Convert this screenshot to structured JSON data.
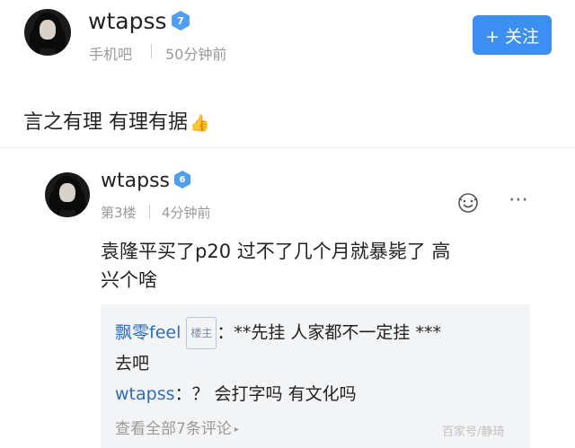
{
  "post": {
    "username": "wtapss",
    "level": "7",
    "source": "手机吧",
    "time": "50分钟前",
    "follow_label": "+ 关注",
    "content": "言之有理 有理有据",
    "content_emoji": "👍"
  },
  "reply": {
    "username": "wtapss",
    "level": "6",
    "floor": "第3楼",
    "time": "4分钟前",
    "content_line1": "袁隆平买了p20 过不了几个月就暴毙了 高",
    "content_line2": "兴个啥",
    "sub_comments": [
      {
        "user": "飘零feel",
        "badge": "楼主",
        "sep": "：",
        "text_line1": "**先挂 人家都不一定挂 ***",
        "text_line2": "去吧"
      },
      {
        "user": "wtapss",
        "sep": "：",
        "text": "？ 会打字吗 有文化吗"
      }
    ],
    "view_all": "查看全部7条评论",
    "more_icon": "⋯"
  },
  "watermark": "百家号/静琦",
  "colors": {
    "accent": "#3c8ff0",
    "link_user": "#2f6db5",
    "meta_gray": "#999999"
  }
}
